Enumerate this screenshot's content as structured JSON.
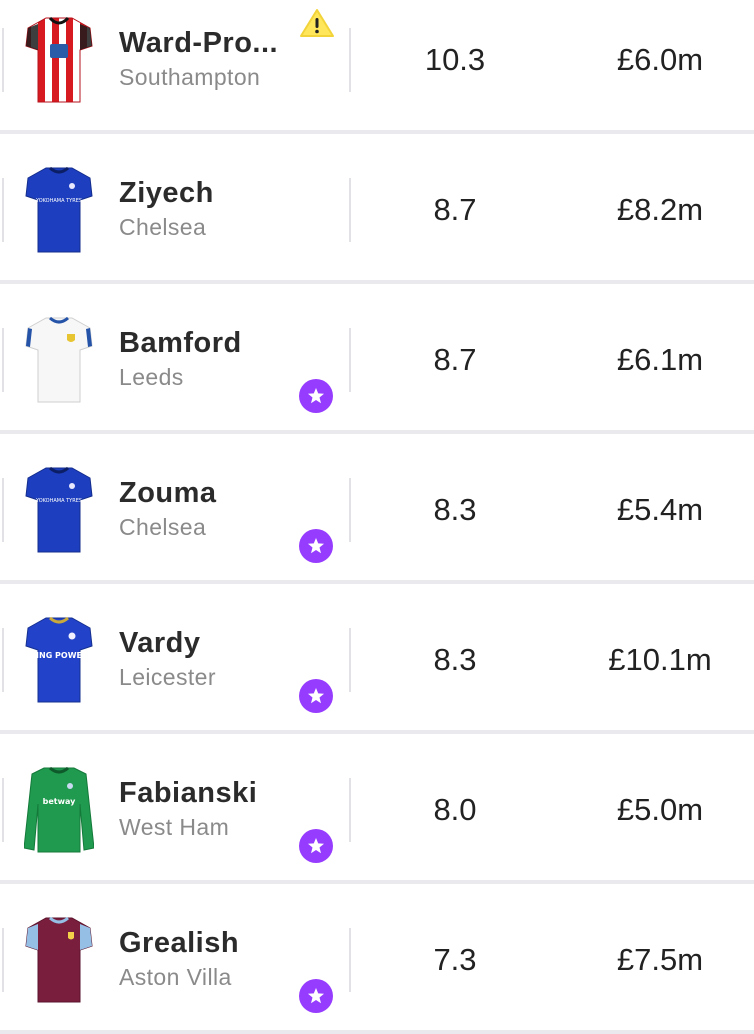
{
  "players": [
    {
      "name": "Ward-Pro...",
      "team": "Southampton",
      "points": "10.3",
      "price": "£6.0m",
      "flag": "warning",
      "kit": "southampton"
    },
    {
      "name": "Ziyech",
      "team": "Chelsea",
      "points": "8.7",
      "price": "£8.2m",
      "flag": "",
      "kit": "chelsea"
    },
    {
      "name": "Bamford",
      "team": "Leeds",
      "points": "8.7",
      "price": "£6.1m",
      "flag": "star",
      "kit": "leeds"
    },
    {
      "name": "Zouma",
      "team": "Chelsea",
      "points": "8.3",
      "price": "£5.4m",
      "flag": "star",
      "kit": "chelsea"
    },
    {
      "name": "Vardy",
      "team": "Leicester",
      "points": "8.3",
      "price": "£10.1m",
      "flag": "star",
      "kit": "leicester"
    },
    {
      "name": "Fabianski",
      "team": "West Ham",
      "points": "8.0",
      "price": "£5.0m",
      "flag": "star",
      "kit": "westham-gk"
    },
    {
      "name": "Grealish",
      "team": "Aston Villa",
      "points": "7.3",
      "price": "£7.5m",
      "flag": "star",
      "kit": "villa"
    }
  ],
  "kit_text": {
    "southampton": "",
    "chelsea": "YOKOHAMA TYRES",
    "leeds": "",
    "leicester": "KING POWER",
    "westham-gk": "betway",
    "villa": ""
  },
  "colors": {
    "star_badge": "#963cff",
    "warning": "#ffe65b",
    "name_text": "#2b2b2b",
    "team_text": "#8a8a8a",
    "separator": "#e9e9ee"
  }
}
